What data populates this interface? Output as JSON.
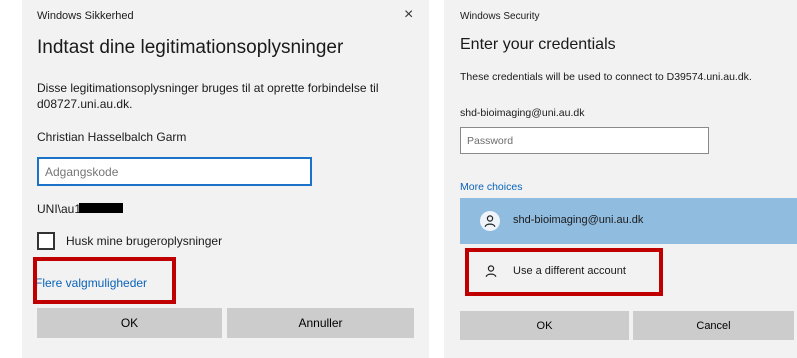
{
  "left_dialog": {
    "app_title": "Windows Sikkerhed",
    "close_glyph": "×",
    "heading": "Indtast dine legitimationsoplysninger",
    "description": "Disse legitimationsoplysninger bruges til at oprette forbindelse til d08727.uni.au.dk.",
    "username": "Christian Hasselbalch Garm",
    "password_placeholder": "Adgangskode",
    "domain_user": "UNI\\au14",
    "remember_label": "Husk mine brugeroplysninger",
    "more_choices": "Flere valgmuligheder",
    "ok_label": "OK",
    "cancel_label": "Annuller"
  },
  "right_dialog": {
    "app_title": "Windows Security",
    "heading": "Enter your credentials",
    "description": "These credentials will be used to connect to D39574.uni.au.dk.",
    "username": "shd-bioimaging@uni.au.dk",
    "password_placeholder": "Password",
    "more_choices": "More choices",
    "account_option": "shd-bioimaging@uni.au.dk",
    "different_account": "Use a different account",
    "ok_label": "OK",
    "cancel_label": "Cancel"
  },
  "colors": {
    "highlight": "#c00000",
    "link": "#0a63b8",
    "selected_account": "#90bce0",
    "focus_border": "#1a73c8"
  }
}
